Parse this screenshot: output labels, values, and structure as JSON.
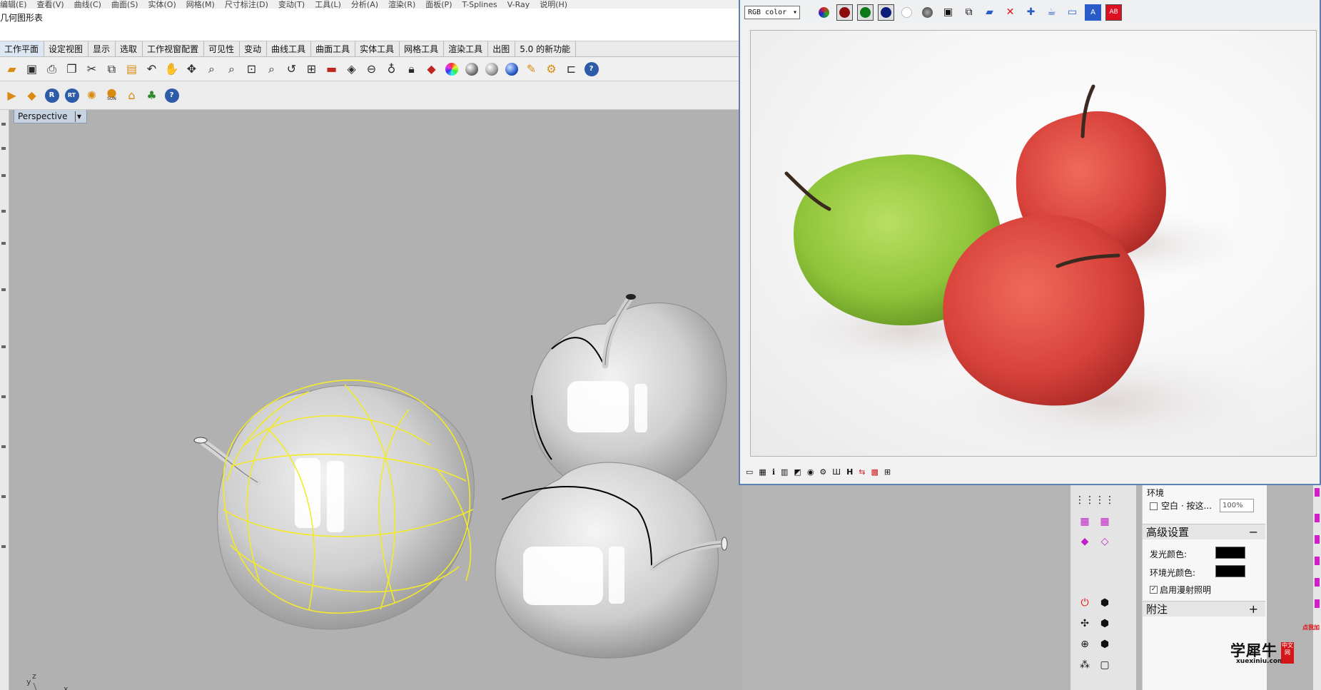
{
  "menubar": {
    "items": [
      "编辑(E)",
      "查看(V)",
      "曲线(C)",
      "曲面(S)",
      "实体(O)",
      "网格(M)",
      "尺寸标注(D)",
      "变动(T)",
      "工具(L)",
      "分析(A)",
      "渲染(R)",
      "面板(P)",
      "T-Splines",
      "V-Ray",
      "说明(H)"
    ]
  },
  "command_line": {
    "text": "几何图形表"
  },
  "toolbar_tabs": [
    "工作平面",
    "设定视图",
    "显示",
    "选取",
    "工作视窗配置",
    "可见性",
    "变动",
    "曲线工具",
    "曲面工具",
    "实体工具",
    "网格工具",
    "渲染工具",
    "出图",
    "5.0 的新功能"
  ],
  "toolbar2": {
    "sun_label": "SUN",
    "r_label": "R",
    "rt_label": "RT",
    "help_label": "?"
  },
  "viewport": {
    "tab_label": "Perspective",
    "axis_labels": {
      "x": "x",
      "y": "y",
      "z": "z"
    }
  },
  "vray_window": {
    "channel_select": "RGB color",
    "status_letter": "H"
  },
  "properties": {
    "environment_label": "环境",
    "blank_checkbox_label": "空白 · 按这...",
    "intensity_value": "100%",
    "advanced_section": "高级设置",
    "emission_color_label": "发光颜色:",
    "ambient_color_label": "环境光颜色:",
    "diffuse_lighting_label": "启用漫射照明",
    "notes_section": "附注",
    "collapse_symbol": "−",
    "expand_symbol": "+"
  },
  "watermark": {
    "cn": "学犀牛",
    "en": "xuexiniu.com",
    "seal": "中文网"
  },
  "corner_badge": {
    "text": "点我加"
  },
  "colors": {
    "accent_blue": "#5c80b4",
    "viewport_bg": "#b1b1b1",
    "highlight_yellow": "#f2ea2a",
    "apple_green": "#8fc53a",
    "apple_red": "#d8423b"
  }
}
